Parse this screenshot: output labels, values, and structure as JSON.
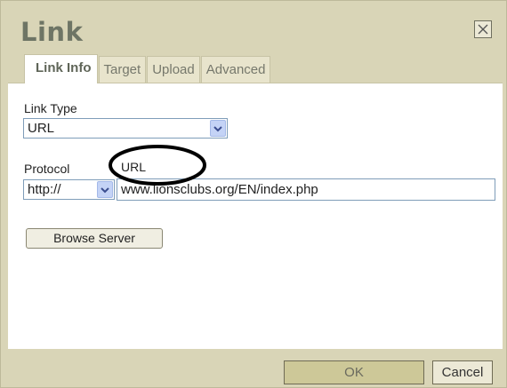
{
  "dialog": {
    "title": "Link",
    "close_icon": "close-x-icon"
  },
  "tabs": [
    {
      "label": "Link Info",
      "active": true
    },
    {
      "label": "Target",
      "active": false
    },
    {
      "label": "Upload",
      "active": false
    },
    {
      "label": "Advanced",
      "active": false
    }
  ],
  "link_type": {
    "label": "Link Type",
    "selected": "URL"
  },
  "protocol": {
    "label": "Protocol",
    "selected": "http://"
  },
  "url": {
    "label": "URL",
    "value": "www.lionsclubs.org/EN/index.php"
  },
  "browse_button": "Browse Server",
  "footer": {
    "ok_label": "OK",
    "cancel_label": "Cancel"
  },
  "colors": {
    "dialog_bg": "#d9d5b7",
    "title": "#6e7565",
    "ok_button": "#cdc898",
    "annotation": "#000000"
  }
}
